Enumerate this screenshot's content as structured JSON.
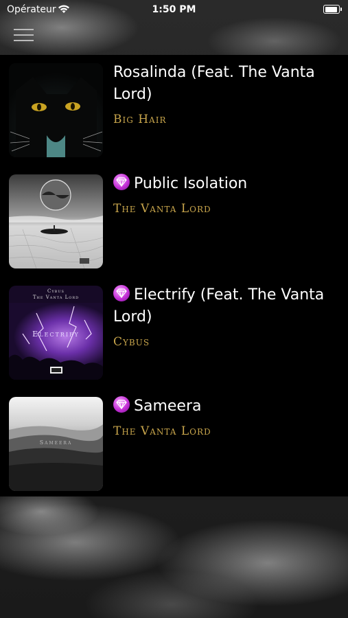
{
  "status_bar": {
    "carrier": "Opérateur",
    "time": "1:50 PM"
  },
  "header": {
    "menu_icon": "hamburger-menu-icon"
  },
  "tracks": [
    {
      "title": "Rosalinda (Feat. The Vanta Lord)",
      "artist": "Big Hair",
      "badge": false,
      "cover": "black-cat-cover"
    },
    {
      "title": "Public Isolation",
      "artist": "The Vanta Lord",
      "badge": true,
      "cover": "salt-flat-sphere-cover"
    },
    {
      "title": "Electrify (Feat. The Vanta Lord)",
      "artist": "Cybus",
      "badge": true,
      "cover": "purple-lightning-cover",
      "cover_text": {
        "line1": "Cybus",
        "line2": "The Vanta Lord",
        "title": "Electrify"
      }
    },
    {
      "title": "Sameera",
      "artist": "The Vanta Lord",
      "badge": true,
      "cover": "misty-hills-cover",
      "cover_text": {
        "title": "Sameera"
      }
    }
  ],
  "colors": {
    "artist_text": "#c9a64c",
    "badge": "#c42fd6",
    "list_background": "#000000"
  }
}
